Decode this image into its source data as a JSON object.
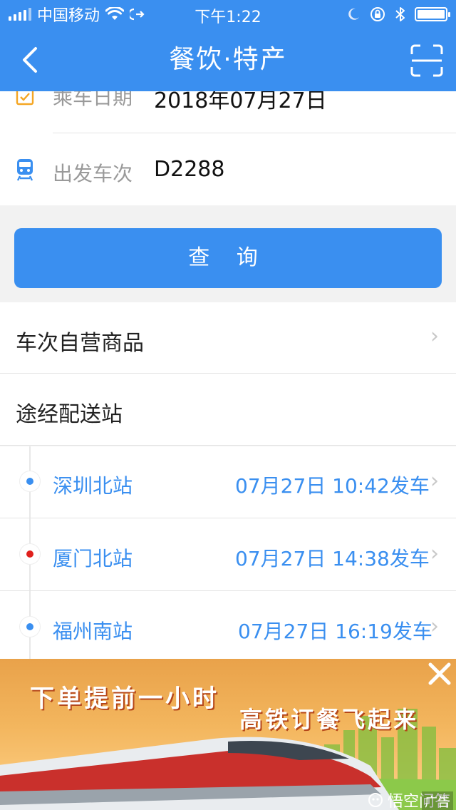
{
  "status_bar": {
    "carrier": "中国移动",
    "time": "下午1:22"
  },
  "nav": {
    "title": "餐饮·特产"
  },
  "form": {
    "date_label": "乘车日期",
    "date_value": "2018年07月27日",
    "train_label": "出发车次",
    "train_value": "D2288"
  },
  "query_button": "查 询",
  "sections": {
    "train_goods": "车次自营商品",
    "stations_title": "途经配送站"
  },
  "stations": [
    {
      "name": "深圳北站",
      "time": "07月27日 10:42发车",
      "dot_color": "#3a8ff0"
    },
    {
      "name": "厦门北站",
      "time": "07月27日 14:38发车",
      "dot_color": "#e0201c"
    },
    {
      "name": "福州南站",
      "time": "07月27日 16:19发车",
      "dot_color": "#3a8ff0"
    }
  ],
  "ad": {
    "line1": "下单提前一小时",
    "line2": "高铁订餐飞起来",
    "label": "广告",
    "watermark": "悟空问答"
  },
  "colors": {
    "brand_blue": "#3a8ff0",
    "accent_orange": "#f5a623",
    "alert_red": "#e0201c"
  }
}
